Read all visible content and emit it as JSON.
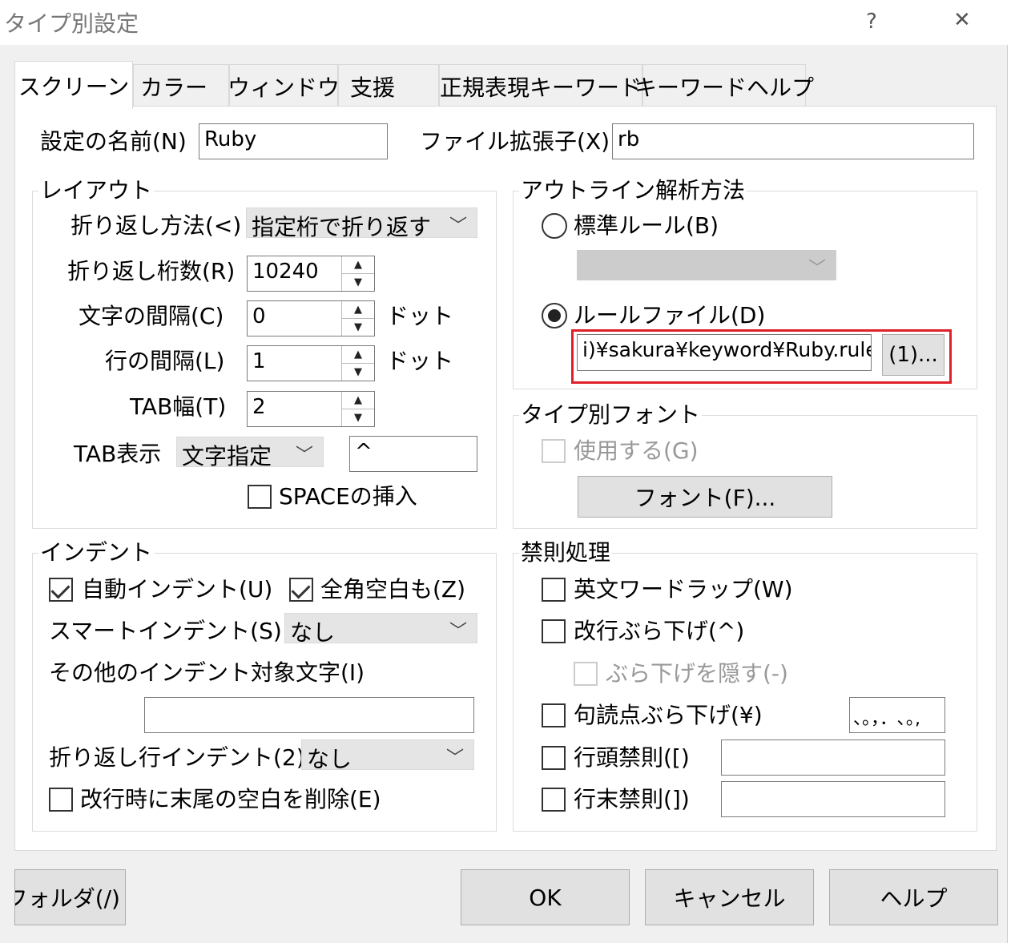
{
  "window": {
    "title": "タイプ別設定",
    "help_label": "?",
    "close_label": "✕"
  },
  "tabs": [
    "スクリーン",
    "カラー",
    "ウィンドウ",
    "支援",
    "正規表現キーワード",
    "キーワードヘルプ"
  ],
  "top": {
    "name_label": "設定の名前(N)",
    "name_value": "Ruby",
    "ext_label": "ファイル拡張子(X)",
    "ext_value": "rb"
  },
  "layout": {
    "title": "レイアウト",
    "wrap_method_label": "折り返し方法(<)",
    "wrap_method_value": "指定桁で折り返す",
    "wrap_cols_label": "折り返し桁数(R)",
    "wrap_cols_value": "10240",
    "char_gap_label": "文字の間隔(C)",
    "char_gap_value": "0",
    "line_gap_label": "行の間隔(L)",
    "line_gap_value": "1",
    "dot_label": "ドット",
    "tab_width_label": "TAB幅(T)",
    "tab_width_value": "2",
    "tab_display_label": "TAB表示",
    "tab_display_value": "文字指定",
    "tab_char_value": "^",
    "space_insert_label": "SPACEの挿入"
  },
  "outline": {
    "title": "アウトライン解析方法",
    "standard_rule_label": "標準ルール(B)",
    "rule_file_label": "ルールファイル(D)",
    "rule_file_value": "i)¥sakura¥keyword¥Ruby.rule",
    "browse_label": "(1)..."
  },
  "font": {
    "title": "タイプ別フォント",
    "use_label": "使用する(G)",
    "font_button": "フォント(F)..."
  },
  "indent": {
    "title": "インデント",
    "auto_indent_label": "自動インデント(U)",
    "fullwidth_label": "全角空白も(Z)",
    "smart_indent_label": "スマートインデント(S)",
    "smart_indent_value": "なし",
    "other_chars_label": "その他のインデント対象文字(I)",
    "other_chars_value": "",
    "wrap_indent_label": "折り返し行インデント(2)",
    "wrap_indent_value": "なし",
    "trim_trailing_label": "改行時に末尾の空白を削除(E)"
  },
  "kinsoku": {
    "title": "禁則処理",
    "word_wrap_label": "英文ワードラップ(W)",
    "newline_hang_label": "改行ぶら下げ(^)",
    "hide_hang_label": "ぶら下げを隠す(-)",
    "punct_hang_label": "句読点ぶら下げ(¥)",
    "punct_value": "、。，．､｡,",
    "head_label": "行頭禁則([)",
    "head_value": "",
    "tail_label": "行末禁則(])",
    "tail_value": ""
  },
  "footer": {
    "folder_label": "定フォルダ(/)",
    "ok_label": "OK",
    "cancel_label": "キャンセル",
    "help_label": "ヘルプ"
  }
}
